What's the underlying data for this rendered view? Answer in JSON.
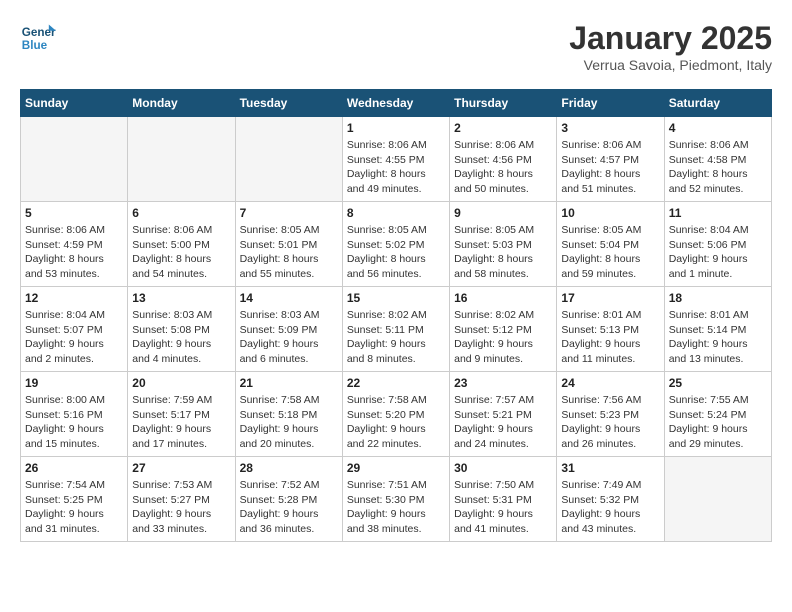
{
  "logo": {
    "line1": "General",
    "line2": "Blue"
  },
  "title": "January 2025",
  "subtitle": "Verrua Savoia, Piedmont, Italy",
  "days_of_week": [
    "Sunday",
    "Monday",
    "Tuesday",
    "Wednesday",
    "Thursday",
    "Friday",
    "Saturday"
  ],
  "weeks": [
    [
      {
        "day": "",
        "empty": true
      },
      {
        "day": "",
        "empty": true
      },
      {
        "day": "",
        "empty": true
      },
      {
        "day": "1",
        "sunrise": "8:06 AM",
        "sunset": "4:55 PM",
        "daylight": "8 hours and 49 minutes."
      },
      {
        "day": "2",
        "sunrise": "8:06 AM",
        "sunset": "4:56 PM",
        "daylight": "8 hours and 50 minutes."
      },
      {
        "day": "3",
        "sunrise": "8:06 AM",
        "sunset": "4:57 PM",
        "daylight": "8 hours and 51 minutes."
      },
      {
        "day": "4",
        "sunrise": "8:06 AM",
        "sunset": "4:58 PM",
        "daylight": "8 hours and 52 minutes."
      }
    ],
    [
      {
        "day": "5",
        "sunrise": "8:06 AM",
        "sunset": "4:59 PM",
        "daylight": "8 hours and 53 minutes."
      },
      {
        "day": "6",
        "sunrise": "8:06 AM",
        "sunset": "5:00 PM",
        "daylight": "8 hours and 54 minutes."
      },
      {
        "day": "7",
        "sunrise": "8:05 AM",
        "sunset": "5:01 PM",
        "daylight": "8 hours and 55 minutes."
      },
      {
        "day": "8",
        "sunrise": "8:05 AM",
        "sunset": "5:02 PM",
        "daylight": "8 hours and 56 minutes."
      },
      {
        "day": "9",
        "sunrise": "8:05 AM",
        "sunset": "5:03 PM",
        "daylight": "8 hours and 58 minutes."
      },
      {
        "day": "10",
        "sunrise": "8:05 AM",
        "sunset": "5:04 PM",
        "daylight": "8 hours and 59 minutes."
      },
      {
        "day": "11",
        "sunrise": "8:04 AM",
        "sunset": "5:06 PM",
        "daylight": "9 hours and 1 minute."
      }
    ],
    [
      {
        "day": "12",
        "sunrise": "8:04 AM",
        "sunset": "5:07 PM",
        "daylight": "9 hours and 2 minutes."
      },
      {
        "day": "13",
        "sunrise": "8:03 AM",
        "sunset": "5:08 PM",
        "daylight": "9 hours and 4 minutes."
      },
      {
        "day": "14",
        "sunrise": "8:03 AM",
        "sunset": "5:09 PM",
        "daylight": "9 hours and 6 minutes."
      },
      {
        "day": "15",
        "sunrise": "8:02 AM",
        "sunset": "5:11 PM",
        "daylight": "9 hours and 8 minutes."
      },
      {
        "day": "16",
        "sunrise": "8:02 AM",
        "sunset": "5:12 PM",
        "daylight": "9 hours and 9 minutes."
      },
      {
        "day": "17",
        "sunrise": "8:01 AM",
        "sunset": "5:13 PM",
        "daylight": "9 hours and 11 minutes."
      },
      {
        "day": "18",
        "sunrise": "8:01 AM",
        "sunset": "5:14 PM",
        "daylight": "9 hours and 13 minutes."
      }
    ],
    [
      {
        "day": "19",
        "sunrise": "8:00 AM",
        "sunset": "5:16 PM",
        "daylight": "9 hours and 15 minutes."
      },
      {
        "day": "20",
        "sunrise": "7:59 AM",
        "sunset": "5:17 PM",
        "daylight": "9 hours and 17 minutes."
      },
      {
        "day": "21",
        "sunrise": "7:58 AM",
        "sunset": "5:18 PM",
        "daylight": "9 hours and 20 minutes."
      },
      {
        "day": "22",
        "sunrise": "7:58 AM",
        "sunset": "5:20 PM",
        "daylight": "9 hours and 22 minutes."
      },
      {
        "day": "23",
        "sunrise": "7:57 AM",
        "sunset": "5:21 PM",
        "daylight": "9 hours and 24 minutes."
      },
      {
        "day": "24",
        "sunrise": "7:56 AM",
        "sunset": "5:23 PM",
        "daylight": "9 hours and 26 minutes."
      },
      {
        "day": "25",
        "sunrise": "7:55 AM",
        "sunset": "5:24 PM",
        "daylight": "9 hours and 29 minutes."
      }
    ],
    [
      {
        "day": "26",
        "sunrise": "7:54 AM",
        "sunset": "5:25 PM",
        "daylight": "9 hours and 31 minutes."
      },
      {
        "day": "27",
        "sunrise": "7:53 AM",
        "sunset": "5:27 PM",
        "daylight": "9 hours and 33 minutes."
      },
      {
        "day": "28",
        "sunrise": "7:52 AM",
        "sunset": "5:28 PM",
        "daylight": "9 hours and 36 minutes."
      },
      {
        "day": "29",
        "sunrise": "7:51 AM",
        "sunset": "5:30 PM",
        "daylight": "9 hours and 38 minutes."
      },
      {
        "day": "30",
        "sunrise": "7:50 AM",
        "sunset": "5:31 PM",
        "daylight": "9 hours and 41 minutes."
      },
      {
        "day": "31",
        "sunrise": "7:49 AM",
        "sunset": "5:32 PM",
        "daylight": "9 hours and 43 minutes."
      },
      {
        "day": "",
        "empty": true
      }
    ]
  ]
}
